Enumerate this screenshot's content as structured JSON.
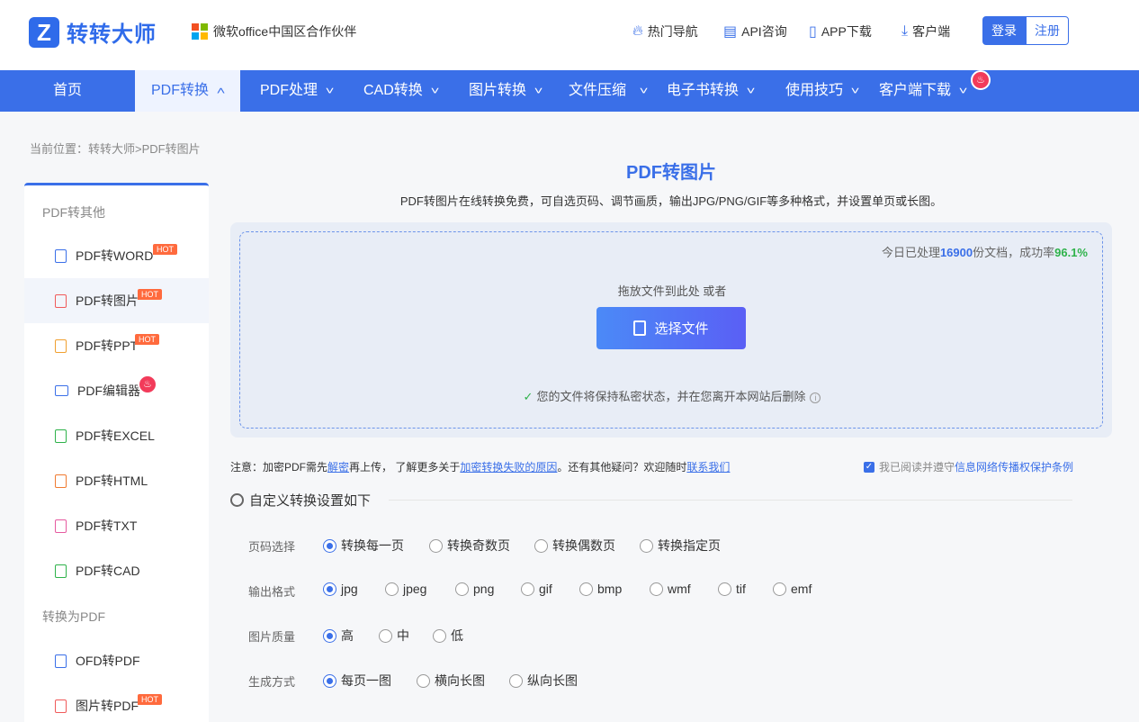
{
  "header": {
    "logo_mark": "Z",
    "brand": "转转大师",
    "partner": "微软office中国区合作伙伴",
    "links": {
      "hot_nav": "热门导航",
      "api": "API咨询",
      "app": "APP下载",
      "client": "客户端"
    },
    "login": "登录",
    "register": "注册"
  },
  "nav": {
    "home": "首页",
    "pdf_convert": "PDF转换",
    "pdf_process": "PDF处理",
    "cad": "CAD转换",
    "image": "图片转换",
    "compress": "文件压缩",
    "ebook": "电子书转换",
    "tips": "使用技巧",
    "client_download": "客户端下载",
    "active": "PDF转换"
  },
  "breadcrumb": "当前位置：转转大师>PDF转图片",
  "sidebar": {
    "group1": "PDF转其他",
    "group2": "转换为PDF",
    "hot_label": "HOT",
    "items": [
      {
        "label": "PDF转WORD",
        "color": "#3a6fe8"
      },
      {
        "label": "PDF转图片",
        "color": "#f05a5a"
      },
      {
        "label": "PDF转PPT",
        "color": "#f0a030"
      },
      {
        "label": "PDF编辑器",
        "color": "#3a6fe8"
      },
      {
        "label": "PDF转EXCEL",
        "color": "#2eb24a"
      },
      {
        "label": "PDF转HTML",
        "color": "#f07a30"
      },
      {
        "label": "PDF转TXT",
        "color": "#e65aa0"
      },
      {
        "label": "PDF转CAD",
        "color": "#2eb24a"
      },
      {
        "label": "OFD转PDF",
        "color": "#3a6fe8"
      },
      {
        "label": "图片转PDF",
        "color": "#f05a5a"
      }
    ]
  },
  "main": {
    "title": "PDF转图片",
    "subtitle": "PDF转图片在线转换免费，可自选页码、调节画质，输出JPG/PNG/GIF等多种格式，并设置单页或长图。",
    "stats_prefix": "今日已处理",
    "stats_count": "16900",
    "stats_mid": "份文档，成功率",
    "stats_rate": "96.1%",
    "drop_text": "拖放文件到此处 或者",
    "choose_button": "选择文件",
    "privacy": "您的文件将保持私密状态，并在您离开本网站后删除"
  },
  "note": {
    "p1": "注意：加密PDF需先",
    "l1": "解密",
    "p2": "再上传，  了解更多关于",
    "l2": "加密转换失败的原因",
    "p3": "。还有其他疑问？欢迎随时",
    "l3": "联系我们"
  },
  "agree": {
    "prefix": "我已阅读并遵守",
    "link": "信息网络传播权保护条例"
  },
  "settings": {
    "title": "自定义转换设置如下",
    "page_label": "页码选择",
    "page_options": [
      "转换每一页",
      "转换奇数页",
      "转换偶数页",
      "转换指定页"
    ],
    "page_selected": "转换每一页",
    "format_label": "输出格式",
    "format_options": [
      "jpg",
      "jpeg",
      "png",
      "gif",
      "bmp",
      "wmf",
      "tif",
      "emf"
    ],
    "format_selected": "jpg",
    "quality_label": "图片质量",
    "quality_options": [
      "高",
      "中",
      "低"
    ],
    "quality_selected": "高",
    "mode_label": "生成方式",
    "mode_options": [
      "每页一图",
      "横向长图",
      "纵向长图"
    ],
    "mode_selected": "每页一图"
  }
}
